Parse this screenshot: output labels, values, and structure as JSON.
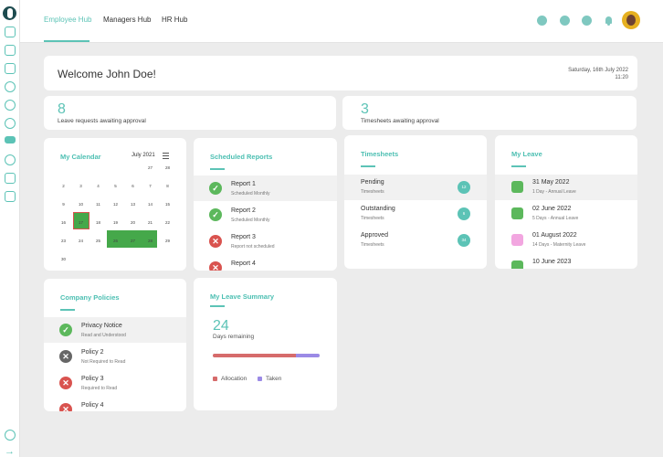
{
  "nav": {
    "tabs": [
      {
        "label": "Employee Hub",
        "active": true
      },
      {
        "label": "Managers Hub",
        "active": false
      },
      {
        "label": "HR Hub",
        "active": false
      }
    ],
    "top_icons": [
      "add-icon",
      "info-icon",
      "help-icon",
      "bell-icon"
    ]
  },
  "sidebar": {
    "icons": [
      "home-icon",
      "card-icon",
      "calendar-icon",
      "clock-icon",
      "check-icon",
      "award-icon",
      "graduation-icon",
      "stethoscope-icon",
      "document-icon",
      "shield-icon",
      "settings-icon",
      "logout-icon"
    ]
  },
  "welcome": {
    "title": "Welcome John Doe!",
    "date": "Saturday, 16th July 2022",
    "time": "11:20"
  },
  "stats": [
    {
      "value": "8",
      "label": "Leave requests awaiting approval"
    },
    {
      "value": "3",
      "label": "Timesheets awaiting approval"
    }
  ],
  "calendar": {
    "title": "My Calendar",
    "month": "July 2021",
    "days": [
      "27",
      "28",
      "2",
      "3",
      "4",
      "5",
      "6",
      "7",
      "8",
      "9",
      "10",
      "11",
      "12",
      "13",
      "14",
      "15",
      "16",
      "17",
      "18",
      "19",
      "20",
      "21",
      "22",
      "23",
      "24",
      "25",
      "26",
      "27",
      "28",
      "29",
      "30"
    ]
  },
  "reports": {
    "title": "Scheduled Reports",
    "items": [
      {
        "title": "Report 1",
        "sub": "Scheduled Monthly",
        "status": "ok"
      },
      {
        "title": "Report 2",
        "sub": "Scheduled Monthly",
        "status": "ok"
      },
      {
        "title": "Report 3",
        "sub": "Report not scheduled",
        "status": "bad"
      },
      {
        "title": "Report 4",
        "sub": "",
        "status": "bad"
      }
    ]
  },
  "timesheets": {
    "title": "Timesheets",
    "items": [
      {
        "title": "Pending",
        "sub": "Timesheets",
        "count": "12"
      },
      {
        "title": "Outstanding",
        "sub": "Timesheets",
        "count": "6"
      },
      {
        "title": "Approved",
        "sub": "Timesheets",
        "count": "34"
      }
    ]
  },
  "leave": {
    "title": "My Leave",
    "items": [
      {
        "title": "31 May 2022",
        "sub": "1 Day - Annual Leave",
        "color": "#5cb85c"
      },
      {
        "title": "02 June 2022",
        "sub": "5 Days - Annual Leave",
        "color": "#5cb85c"
      },
      {
        "title": "01 August 2022",
        "sub": "14 Days - Maternity Leave",
        "color": "#f2a6e0"
      },
      {
        "title": "10 June 2023",
        "sub": "",
        "color": "#5cb85c"
      }
    ]
  },
  "policies": {
    "title": "Company Policies",
    "items": [
      {
        "title": "Privacy Notice",
        "sub": "Read and Understood",
        "status": "ok"
      },
      {
        "title": "Policy 2",
        "sub": "Not Required to Read",
        "status": "grey"
      },
      {
        "title": "Policy 3",
        "sub": "Required to Read",
        "status": "bad"
      },
      {
        "title": "Policy 4",
        "sub": "",
        "status": "bad"
      }
    ]
  },
  "summary": {
    "title": "My Leave Summary",
    "days": "24",
    "label": "Days remaining",
    "allocation_fraction": 0.78,
    "taken_fraction": 0.22,
    "legend": [
      {
        "label": "Allocation",
        "color": "#d66b6b"
      },
      {
        "label": "Taken",
        "color": "#9b8ae6"
      }
    ]
  }
}
